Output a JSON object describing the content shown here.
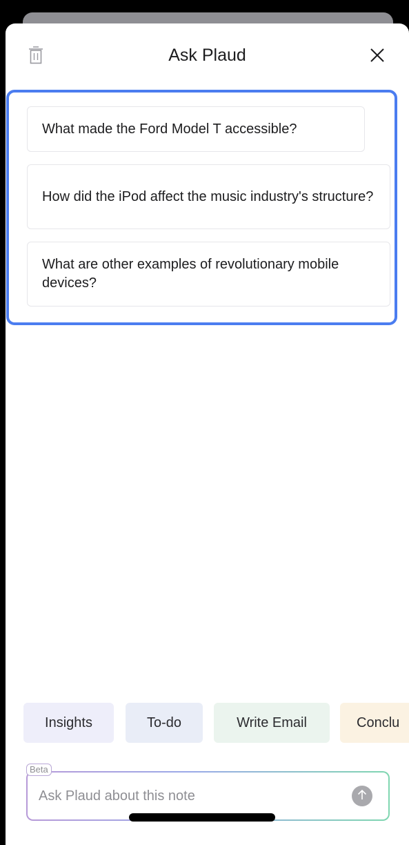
{
  "header": {
    "title": "Ask Plaud",
    "icons": {
      "delete": "trash-icon",
      "close": "close-icon"
    }
  },
  "suggestions": [
    {
      "text": "What made the Ford Model T accessible?"
    },
    {
      "text": "How did the iPod affect the music industry's structure?"
    },
    {
      "text": "What are other examples of revolutionary mobile devices?"
    }
  ],
  "quick_actions": [
    {
      "label": "Insights"
    },
    {
      "label": "To-do"
    },
    {
      "label": "Write Email"
    },
    {
      "label": "Conclu"
    }
  ],
  "ask_input": {
    "badge": "Beta",
    "placeholder": "Ask Plaud about this note",
    "value": "",
    "send_icon": "arrow-up-icon"
  },
  "colors": {
    "highlight_border": "#4b7df0",
    "chip_insights": "#eeeefa",
    "chip_todo": "#e9edf7",
    "chip_email": "#ebf4ee",
    "chip_conclusion": "#fbf2e2",
    "send_button": "#a9a9ad"
  }
}
